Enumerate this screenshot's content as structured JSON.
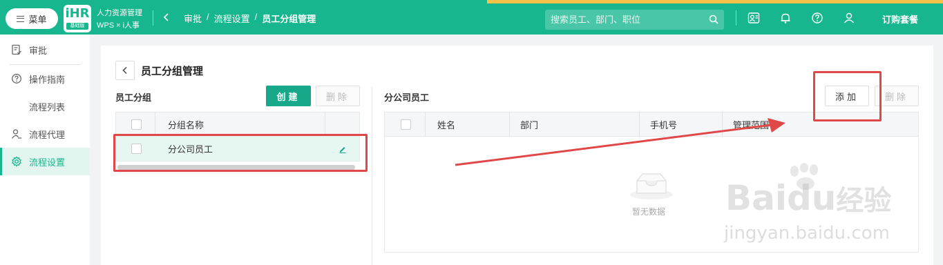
{
  "header": {
    "menu_label": "菜单",
    "logo_mark": "iHR",
    "logo_edition": "基础版",
    "brand_line1": "人力资源管理",
    "brand_line2": "WPS × i人事",
    "breadcrumbs": [
      "审批",
      "/",
      "流程设置",
      "/",
      "员工分组管理"
    ],
    "search_placeholder": "搜索员工、部门、职位",
    "buy_label": "订购套餐",
    "accent": "#17b68f"
  },
  "sidebar": {
    "items": [
      {
        "label": "审批",
        "icon": "approval-doc-icon"
      },
      {
        "label": "操作指南",
        "icon": "help-circle-icon"
      },
      {
        "label": "流程列表",
        "icon": ""
      },
      {
        "label": "流程代理",
        "icon": "person-proxy-icon"
      },
      {
        "label": "流程设置",
        "icon": "gear-icon",
        "active": true
      }
    ]
  },
  "page": {
    "title": "员工分组管理"
  },
  "left_panel": {
    "title": "员工分组",
    "create_label": "创建",
    "delete_label": "删除",
    "columns": [
      "分组名称"
    ],
    "rows": [
      {
        "name": "分公司员工"
      }
    ]
  },
  "right_panel": {
    "title": "分公司员工",
    "add_label": "添加",
    "delete_label": "删除",
    "columns": [
      "姓名",
      "部门",
      "手机号",
      "管理范围"
    ],
    "empty_text": "暂无数据"
  },
  "watermark": {
    "line1": "Bai",
    "line1b": "du",
    "line1c": "经验",
    "line2": "jingyan.baidu.com"
  }
}
